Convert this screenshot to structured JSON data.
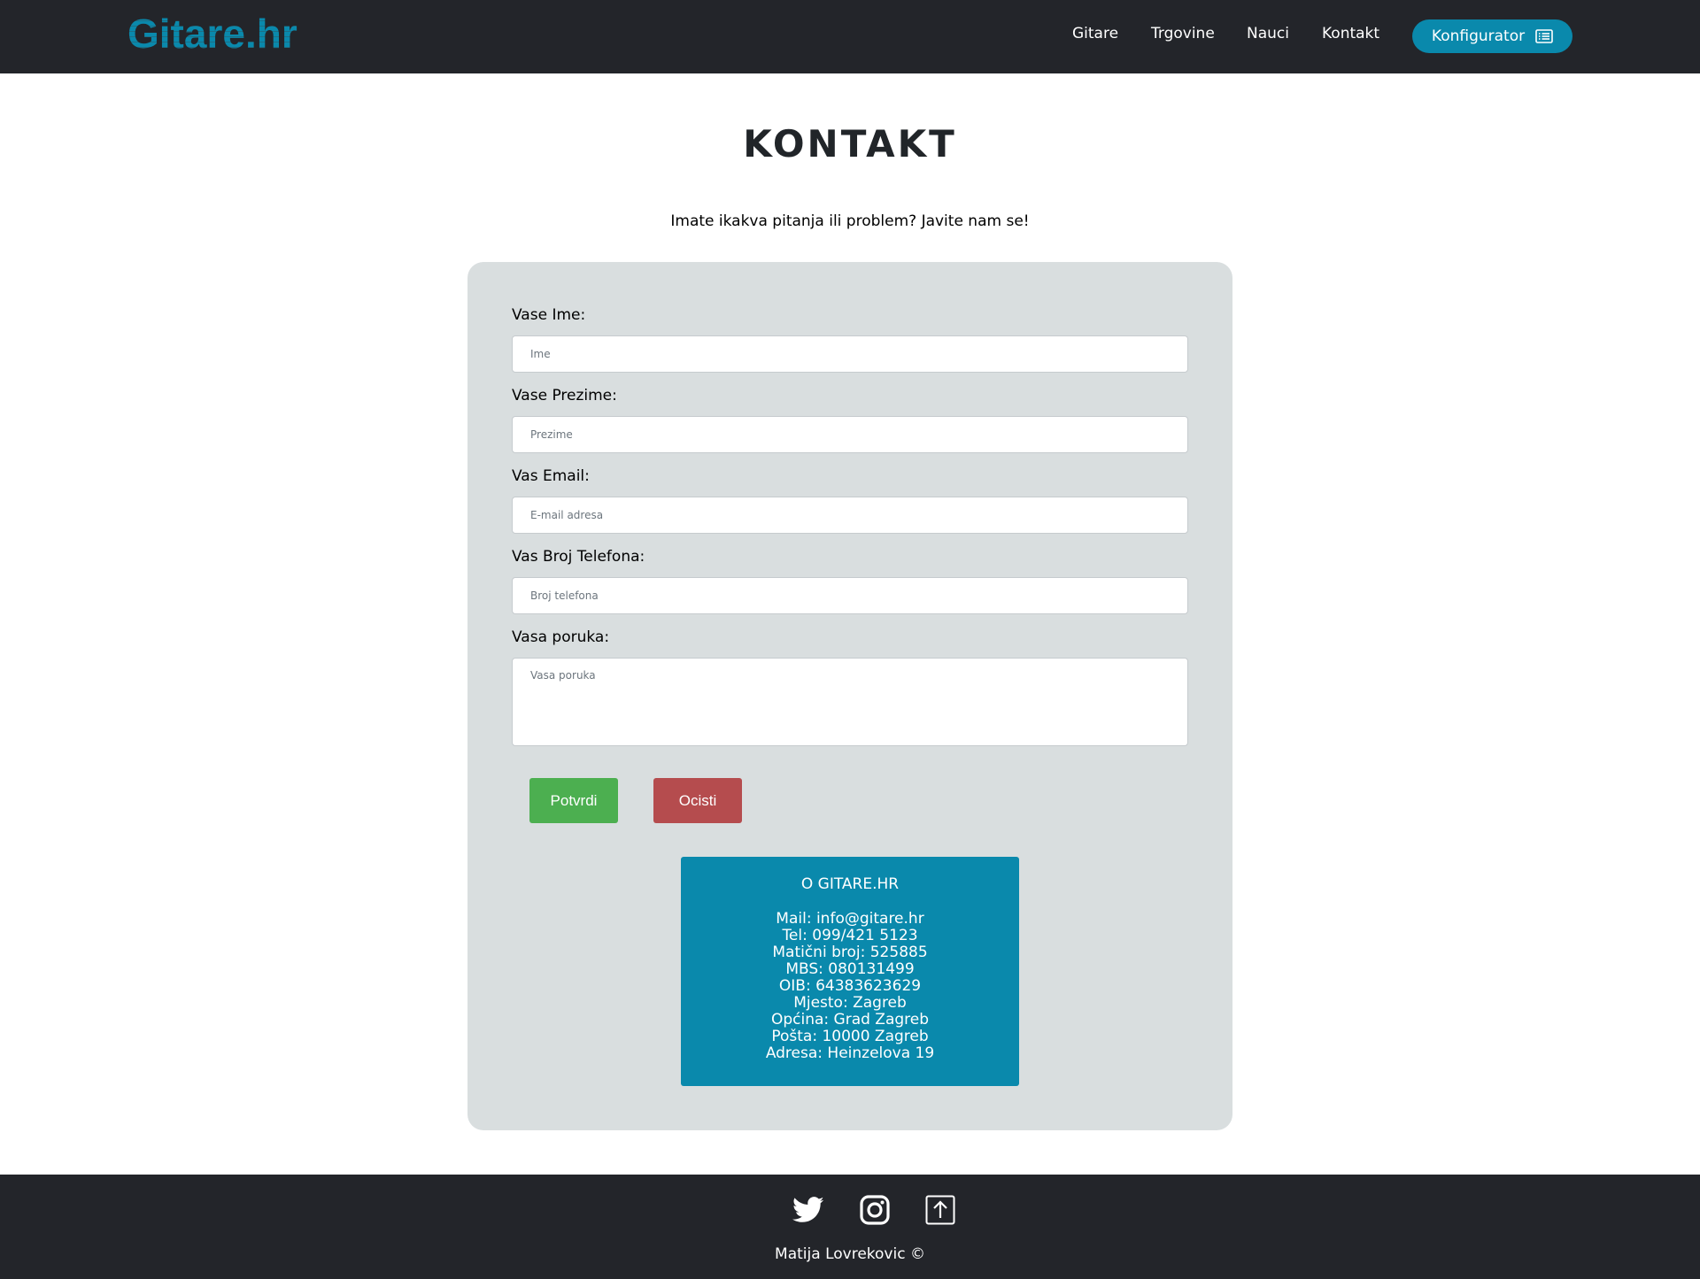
{
  "header": {
    "logo_text": "Gitare.hr",
    "nav": [
      "Gitare",
      "Trgovine",
      "Nauci",
      "Kontakt"
    ],
    "cta_label": "Konfigurator",
    "cta_icon": "list-card-icon"
  },
  "page": {
    "title": "KONTAKT",
    "subtitle": "Imate ikakva pitanja ili problem? Javite nam se!"
  },
  "form": {
    "fields": [
      {
        "label": "Vase Ime:",
        "placeholder": "Ime",
        "value": ""
      },
      {
        "label": "Vase Prezime:",
        "placeholder": "Prezime",
        "value": ""
      },
      {
        "label": "Vas Email:",
        "placeholder": "E-mail adresa",
        "value": ""
      },
      {
        "label": "Vas Broj Telefona:",
        "placeholder": "Broj telefona",
        "value": ""
      }
    ],
    "message": {
      "label": "Vasa poruka:",
      "placeholder": "Vasa poruka",
      "value": ""
    },
    "submit_label": "Potvrdi",
    "clear_label": "Ocisti"
  },
  "info": {
    "title": "O GITARE.HR",
    "lines": [
      "Mail: info@gitare.hr",
      "Tel: 099/421 5123",
      "Matični broj: 525885",
      "MBS: 080131499",
      "OIB: 64383623629",
      "Mjesto: Zagreb",
      "Općina: Grad Zagreb",
      "Pošta: 10000 Zagreb",
      "Adresa: Heinzelova 19"
    ]
  },
  "footer": {
    "icons": [
      "twitter-icon",
      "instagram-icon",
      "arrow-up-icon"
    ],
    "credit": "Matija Lovrekovic ©"
  },
  "colors": {
    "navbar_bg": "#23252a",
    "accent": "#0a89ac",
    "card_bg": "#d9dedf",
    "submit": "#4caf50",
    "clear": "#b54c4e"
  }
}
